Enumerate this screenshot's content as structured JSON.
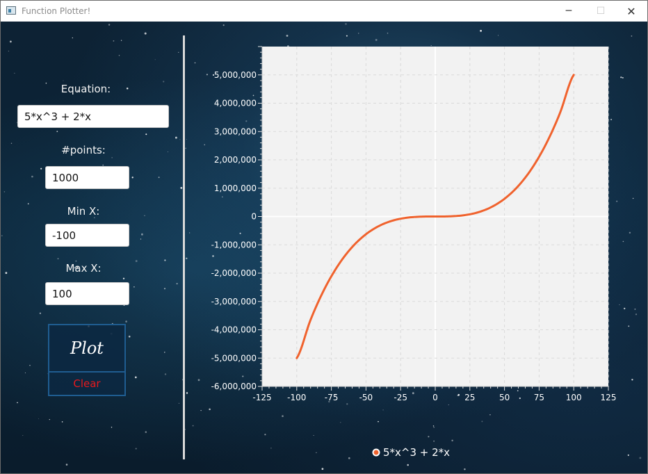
{
  "window": {
    "title": "Function Plotter!",
    "controls": {
      "minimize": "─",
      "maximize": "☐",
      "close": "✕"
    }
  },
  "form": {
    "equation_label": "Equation:",
    "equation_value": "5*x^3 + 2*x",
    "points_label": "#points:",
    "points_value": "1000",
    "minx_label": "Min X:",
    "minx_value": "-100",
    "maxx_label": "Max X:",
    "maxx_value": "100",
    "plot_label": "Plot",
    "clear_label": "Clear"
  },
  "colors": {
    "series_line": "#f0622d",
    "plot_background": "#f2f2f2",
    "clear_text": "#e8191d"
  },
  "chart_data": {
    "type": "line",
    "xlim": [
      -125,
      125
    ],
    "ylim": [
      -6000000,
      6000000
    ],
    "x_ticks": [
      "-125",
      "-100",
      "-75",
      "-50",
      "-25",
      "0",
      "25",
      "50",
      "75",
      "100",
      "125"
    ],
    "y_ticks": [
      "5,000,000",
      "4,000,000",
      "3,000,000",
      "2,000,000",
      "1,000,000",
      "0",
      "-1,000,000",
      "-2,000,000",
      "-3,000,000",
      "-4,000,000",
      "-5,000,000",
      "-6,000,000"
    ],
    "x_tick_values": [
      -125,
      -100,
      -75,
      -50,
      -25,
      0,
      25,
      50,
      75,
      100,
      125
    ],
    "y_tick_values": [
      5000000,
      4000000,
      3000000,
      2000000,
      1000000,
      0,
      -1000000,
      -2000000,
      -3000000,
      -4000000,
      -5000000,
      -6000000
    ],
    "series": [
      {
        "name": "5*x^3 + 2*x",
        "x": [
          -100,
          -90,
          -80,
          -70,
          -60,
          -50,
          -40,
          -30,
          -20,
          -10,
          0,
          10,
          20,
          30,
          40,
          50,
          60,
          70,
          80,
          90,
          100
        ],
        "y": [
          -5000200,
          -3645180,
          -2560160,
          -1715140,
          -1080120,
          -625100,
          -320080,
          -135060,
          -40040,
          -5020,
          0,
          5020,
          40040,
          135060,
          320080,
          625100,
          1080120,
          1715140,
          2560160,
          3645180,
          5000200
        ]
      }
    ],
    "grid": true,
    "legend": "bottom"
  }
}
